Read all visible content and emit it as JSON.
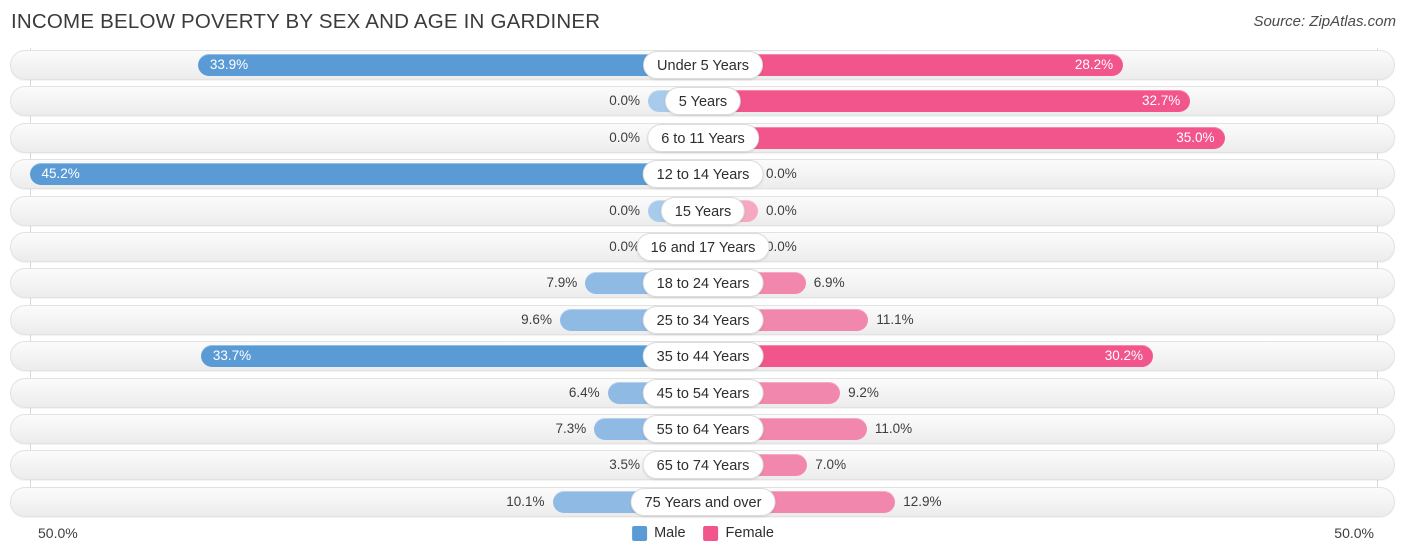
{
  "header": {
    "title": "INCOME BELOW POVERTY BY SEX AND AGE IN GARDINER",
    "source": "Source: ZipAtlas.com"
  },
  "axis": {
    "left_label": "50.0%",
    "right_label": "50.0%"
  },
  "legend": {
    "items": [
      {
        "label": "Male",
        "color": "#5b9bd5"
      },
      {
        "label": "Female",
        "color": "#f2558b"
      }
    ]
  },
  "chart_data": {
    "type": "bar",
    "title": "INCOME BELOW POVERTY BY SEX AND AGE IN GARDINER",
    "subtitle": "Source: ZipAtlas.com",
    "orientation": "horizontal-diverging",
    "xlabel": "",
    "ylabel": "",
    "xlim": [
      50.0,
      50.0
    ],
    "grid": true,
    "legend_position": "bottom-center",
    "categories": [
      "Under 5 Years",
      "5 Years",
      "6 to 11 Years",
      "12 to 14 Years",
      "15 Years",
      "16 and 17 Years",
      "18 to 24 Years",
      "25 to 34 Years",
      "35 to 44 Years",
      "45 to 54 Years",
      "55 to 64 Years",
      "65 to 74 Years",
      "75 Years and over"
    ],
    "series": [
      {
        "name": "Male",
        "color": "#5b9bd5",
        "values": [
          33.9,
          0.0,
          0.0,
          45.2,
          0.0,
          0.0,
          7.9,
          9.6,
          33.7,
          6.4,
          7.3,
          3.5,
          10.1
        ],
        "labels": [
          "33.9%",
          "0.0%",
          "0.0%",
          "45.2%",
          "0.0%",
          "0.0%",
          "7.9%",
          "9.6%",
          "33.7%",
          "6.4%",
          "7.3%",
          "3.5%",
          "10.1%"
        ]
      },
      {
        "name": "Female",
        "color": "#f2558b",
        "values": [
          28.2,
          32.7,
          35.0,
          0.0,
          0.0,
          0.0,
          6.9,
          11.1,
          30.2,
          9.2,
          11.0,
          7.0,
          12.9
        ],
        "labels": [
          "28.2%",
          "32.7%",
          "35.0%",
          "0.0%",
          "0.0%",
          "0.0%",
          "6.9%",
          "11.1%",
          "30.2%",
          "9.2%",
          "11.0%",
          "7.0%",
          "12.9%"
        ]
      }
    ]
  },
  "rows": [
    {
      "category": "Under 5 Years",
      "male": "33.9%",
      "female": "28.2%",
      "male_val": 33.9,
      "female_val": 28.2
    },
    {
      "category": "5 Years",
      "male": "0.0%",
      "female": "32.7%",
      "male_val": 0.0,
      "female_val": 32.7
    },
    {
      "category": "6 to 11 Years",
      "male": "0.0%",
      "female": "35.0%",
      "male_val": 0.0,
      "female_val": 35.0
    },
    {
      "category": "12 to 14 Years",
      "male": "45.2%",
      "female": "0.0%",
      "male_val": 45.2,
      "female_val": 0.0
    },
    {
      "category": "15 Years",
      "male": "0.0%",
      "female": "0.0%",
      "male_val": 0.0,
      "female_val": 0.0
    },
    {
      "category": "16 and 17 Years",
      "male": "0.0%",
      "female": "0.0%",
      "male_val": 0.0,
      "female_val": 0.0
    },
    {
      "category": "18 to 24 Years",
      "male": "7.9%",
      "female": "6.9%",
      "male_val": 7.9,
      "female_val": 6.9
    },
    {
      "category": "25 to 34 Years",
      "male": "9.6%",
      "female": "11.1%",
      "male_val": 9.6,
      "female_val": 11.1
    },
    {
      "category": "35 to 44 Years",
      "male": "33.7%",
      "female": "30.2%",
      "male_val": 33.7,
      "female_val": 30.2
    },
    {
      "category": "45 to 54 Years",
      "male": "6.4%",
      "female": "9.2%",
      "male_val": 6.4,
      "female_val": 9.2
    },
    {
      "category": "55 to 64 Years",
      "male": "7.3%",
      "female": "11.0%",
      "male_val": 7.3,
      "female_val": 11.0
    },
    {
      "category": "65 to 74 Years",
      "male": "3.5%",
      "female": "7.0%",
      "male_val": 3.5,
      "female_val": 7.0
    },
    {
      "category": "75 Years and over",
      "male": "10.1%",
      "female": "12.9%",
      "male_val": 10.1,
      "female_val": 12.9
    }
  ]
}
